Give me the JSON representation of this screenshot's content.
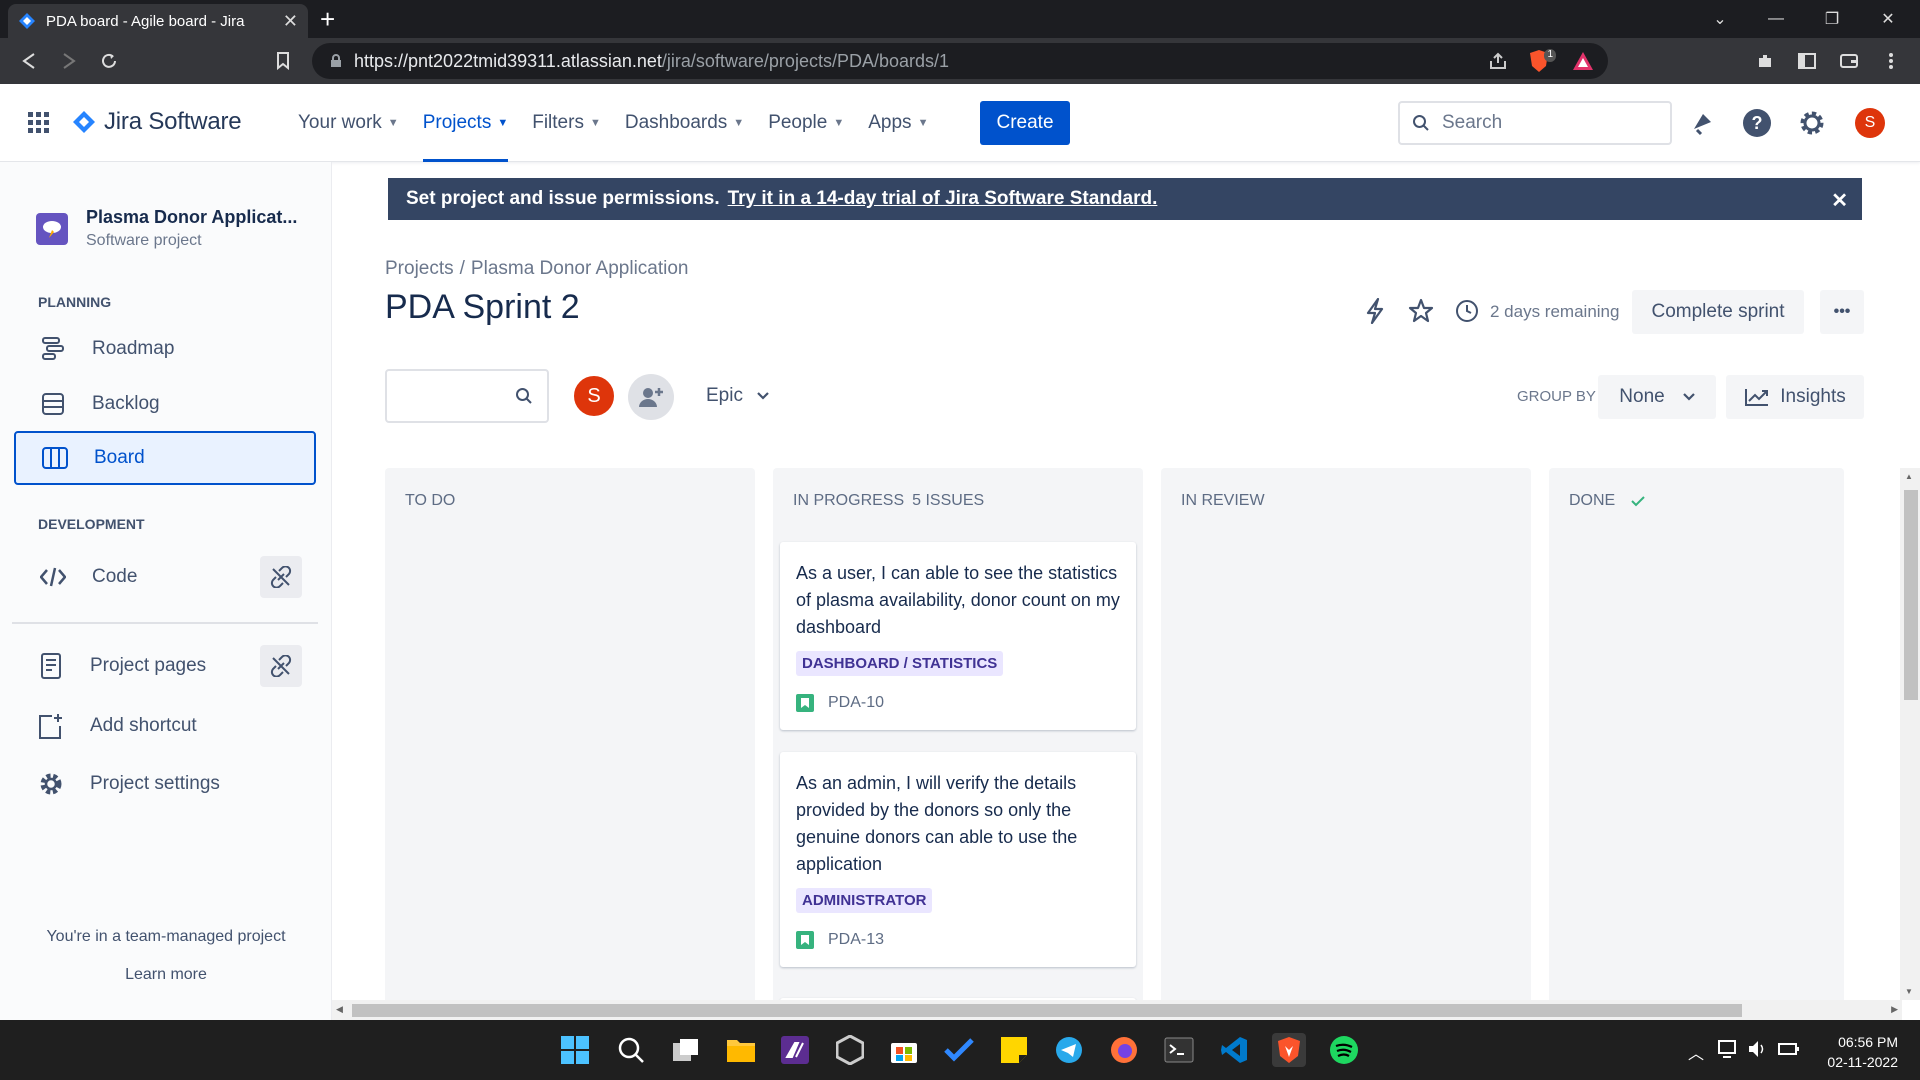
{
  "browser": {
    "tab_title": "PDA board - Agile board - Jira",
    "url_host": "https://pnt2022tmid39311.atlassian.net",
    "url_path": "/jira/software/projects/PDA/boards/1",
    "shield_badge": "1"
  },
  "header": {
    "product": "Jira Software",
    "nav": [
      {
        "label": "Your work"
      },
      {
        "label": "Projects",
        "active": true
      },
      {
        "label": "Filters"
      },
      {
        "label": "Dashboards"
      },
      {
        "label": "People"
      },
      {
        "label": "Apps"
      }
    ],
    "create_label": "Create",
    "search_placeholder": "Search",
    "avatar_initial": "S"
  },
  "sidebar": {
    "project_name": "Plasma Donor Applicat...",
    "project_type": "Software project",
    "planning_label": "PLANNING",
    "planning_items": [
      {
        "label": "Roadmap",
        "icon": "roadmap-icon"
      },
      {
        "label": "Backlog",
        "icon": "backlog-icon"
      },
      {
        "label": "Board",
        "icon": "board-icon",
        "selected": true
      }
    ],
    "development_label": "DEVELOPMENT",
    "code_label": "Code",
    "project_pages_label": "Project pages",
    "add_shortcut_label": "Add shortcut",
    "project_settings_label": "Project settings",
    "footer_text": "You're in a team-managed project",
    "learn_more": "Learn more"
  },
  "banner": {
    "text": "Set project and issue permissions.",
    "link": "Try it in a 14-day trial of Jira Software Standard."
  },
  "breadcrumb": {
    "projects": "Projects",
    "separator": "/",
    "project": "Plasma Donor Application"
  },
  "page_title": "PDA Sprint 2",
  "sprint": {
    "remaining": "2 days remaining",
    "complete_label": "Complete sprint",
    "more_label": "•••"
  },
  "filters": {
    "avatar_initial": "S",
    "epic_label": "Epic",
    "group_by_label": "GROUP BY",
    "group_by_value": "None",
    "insights_label": "Insights"
  },
  "columns": [
    {
      "title": "TO DO",
      "count": ""
    },
    {
      "title": "IN PROGRESS",
      "count": "5 ISSUES"
    },
    {
      "title": "IN REVIEW",
      "count": ""
    },
    {
      "title": "DONE",
      "count": ""
    }
  ],
  "cards": [
    {
      "text": "As a user, I can able to see the statistics of plasma availability, donor count on my dashboard",
      "epic": "DASHBOARD / STATISTICS",
      "key": "PDA-10"
    },
    {
      "text": "As an admin, I will verify the details provided by the donors so only the genuine donors can able to use the application",
      "epic": "ADMINISTRATOR",
      "key": "PDA-13"
    }
  ],
  "taskbar": {
    "time": "06:56 PM",
    "date": "02-11-2022"
  },
  "colors": {
    "brand": "#0052cc",
    "banner_bg": "#344563",
    "avatar": "#de350b",
    "epic_bg": "#eae6ff",
    "epic_text": "#403294",
    "story": "#36b37e",
    "done_check": "#36b37e"
  }
}
